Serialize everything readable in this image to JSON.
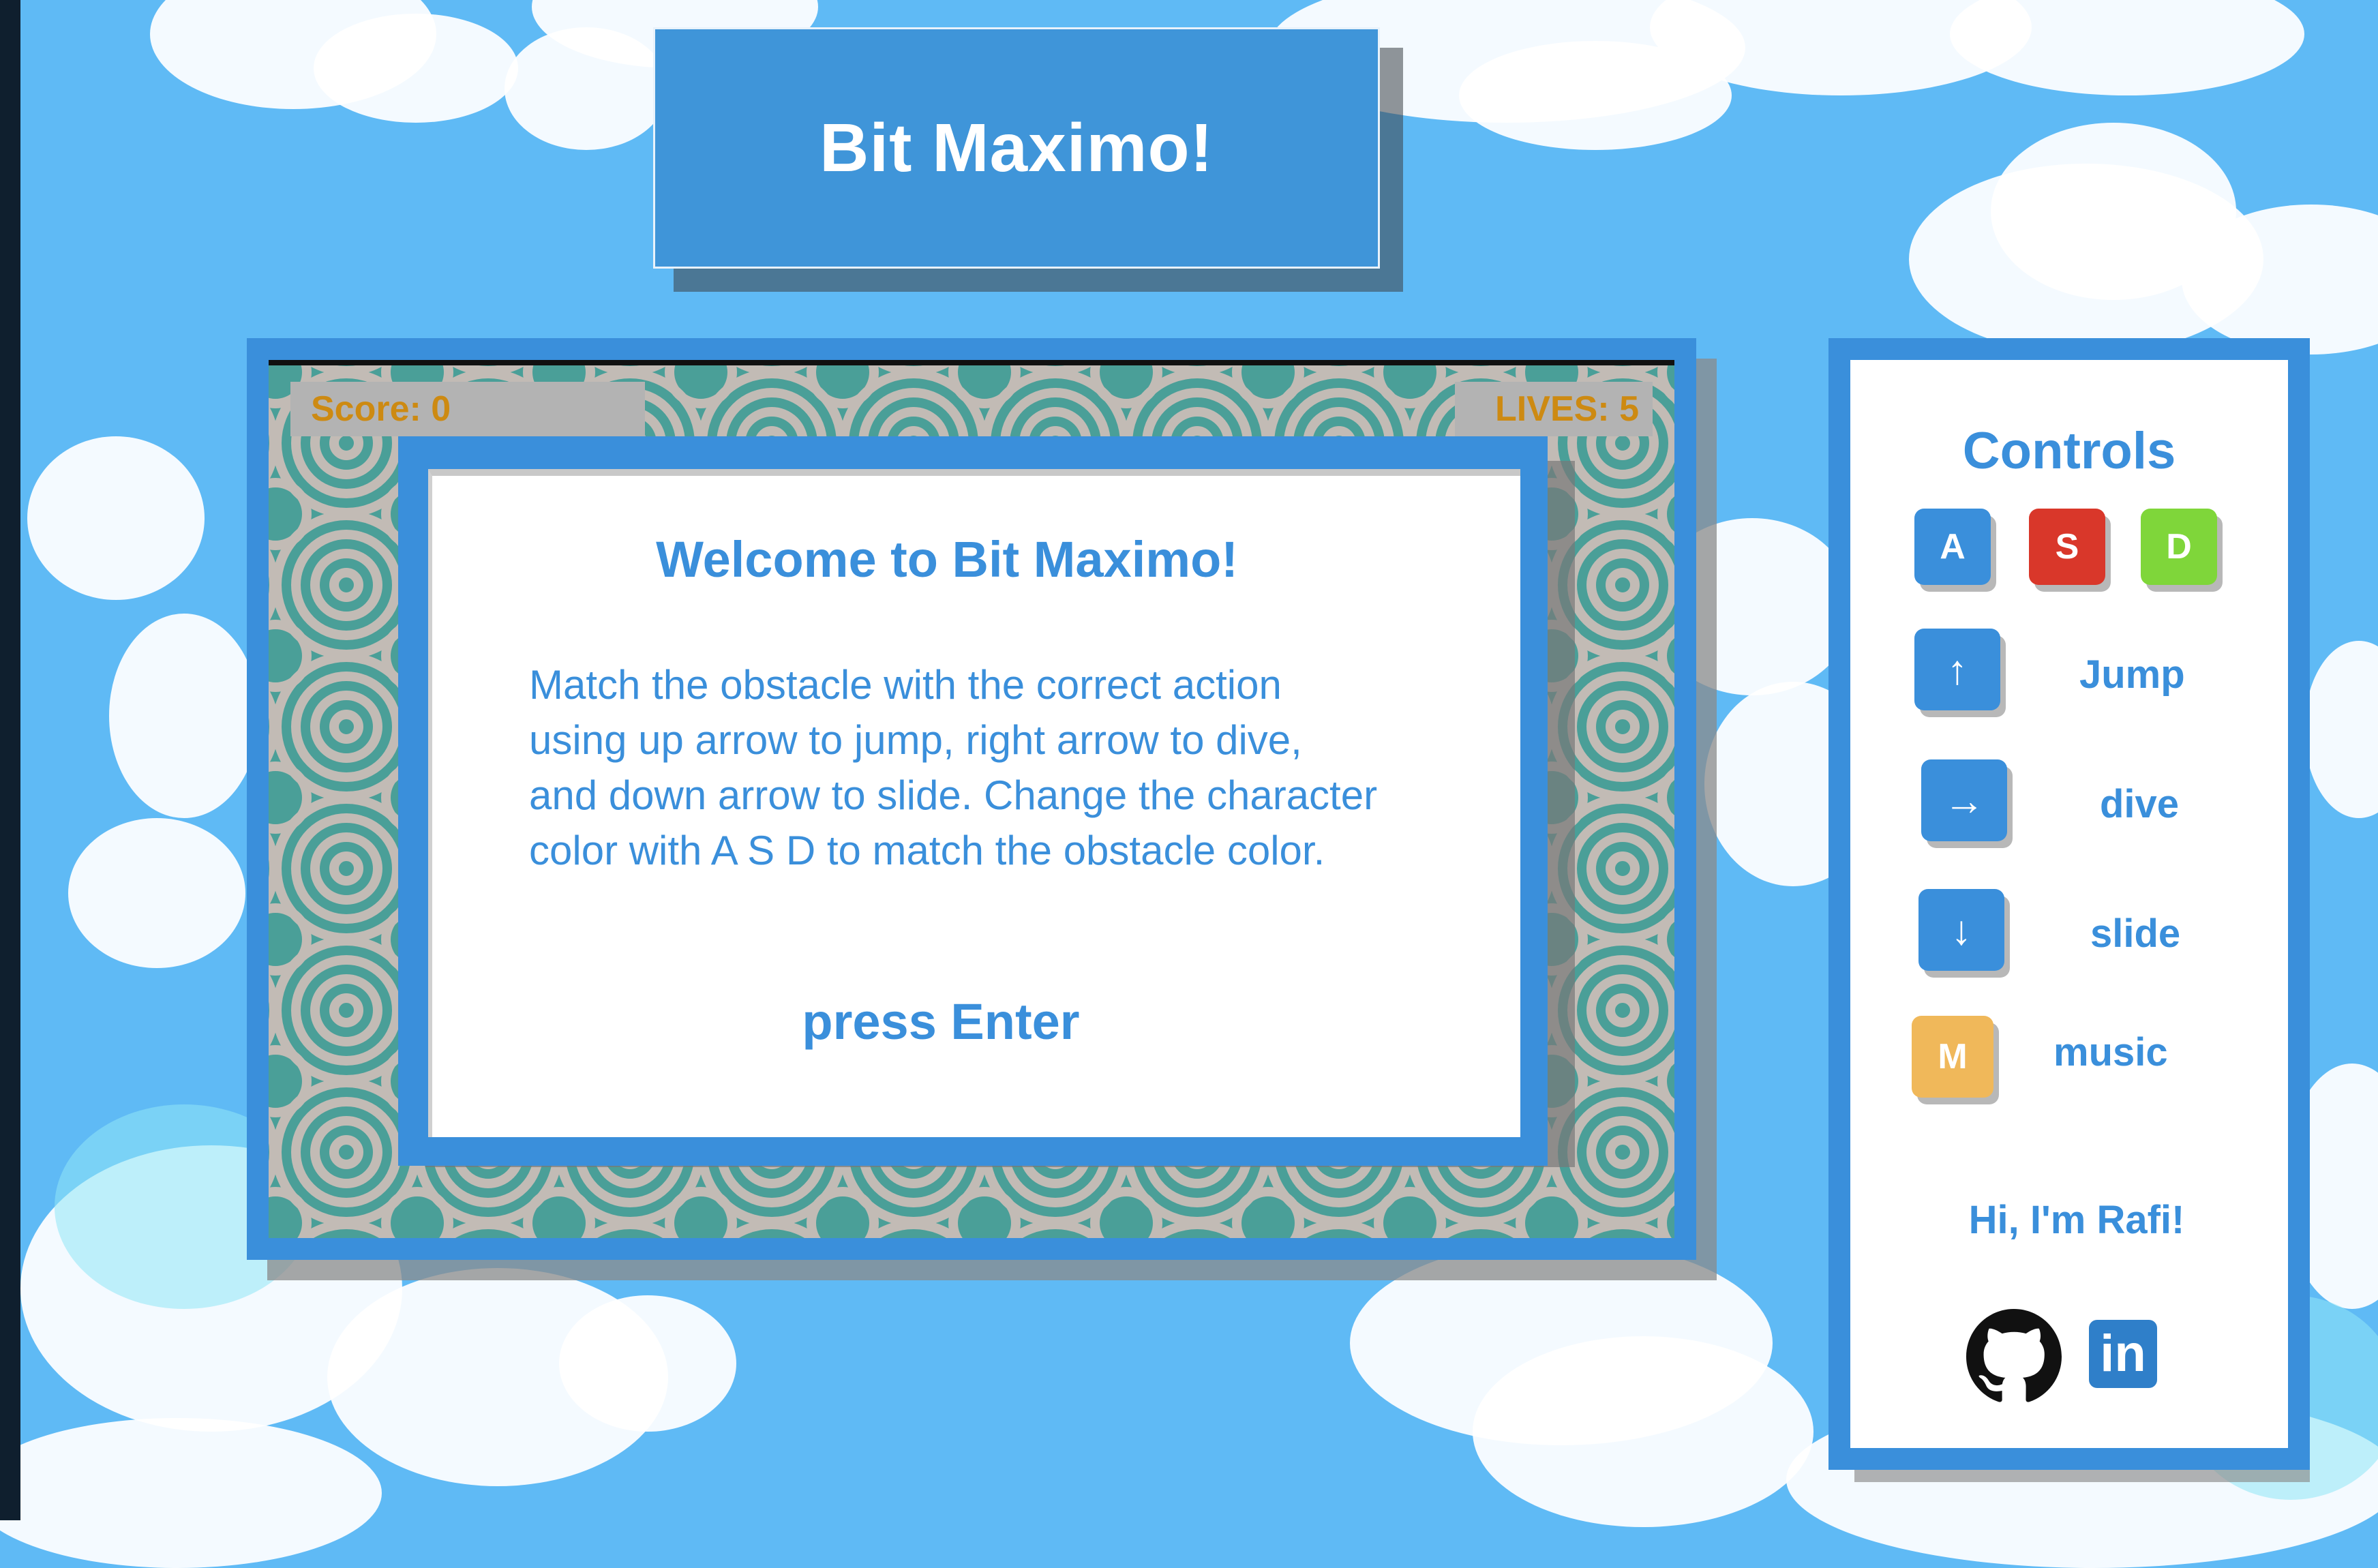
{
  "game": {
    "title": "Bit Maximo!",
    "score_label": "Score: 0",
    "lives_label": "LIVES: 5"
  },
  "welcome": {
    "heading": "Welcome to Bit Maximo!",
    "lines": [
      "Match the obstacle with the correct action",
      "using up arrow to jump, right arrow to dive,",
      "and down arrow to slide. Change the character",
      "color with A S D to match the obstacle color."
    ],
    "prompt": "press Enter"
  },
  "controls": {
    "title": "Controls",
    "color_keys": [
      {
        "key": "A",
        "color": "#3a8fdb"
      },
      {
        "key": "S",
        "color": "#d9372a"
      },
      {
        "key": "D",
        "color": "#7fd63a"
      }
    ],
    "actions": [
      {
        "key": "↑",
        "label": "Jump",
        "icon": "arrow-up-icon"
      },
      {
        "key": "→",
        "label": "dive",
        "icon": "arrow-right-icon"
      },
      {
        "key": "↓",
        "label": "slide",
        "icon": "arrow-down-icon"
      }
    ],
    "music": {
      "key": "M",
      "label": "music",
      "color": "#f0b85a"
    }
  },
  "footer": {
    "greeting": "Hi, I'm Rafi!",
    "github_icon": "github-icon",
    "linkedin_icon": "linkedin-icon",
    "linkedin_text": "in"
  },
  "colors": {
    "sky": "#5fbaf5",
    "accent": "#3a8fdb",
    "hud_text": "#cd8a12",
    "pattern_teal": "#4a9f98",
    "pattern_grey": "#c2bbb5"
  }
}
